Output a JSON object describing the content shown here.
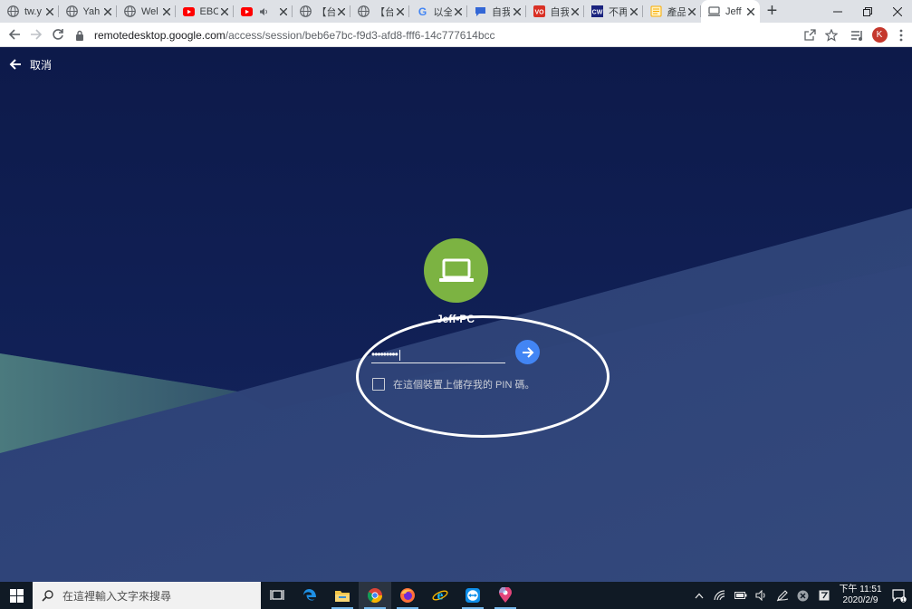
{
  "browser": {
    "tabs": [
      {
        "title": "tw.y",
        "favicon": "globe-icon",
        "color": "#5f6368"
      },
      {
        "title": "Yah",
        "favicon": "globe-icon",
        "color": "#5f6368"
      },
      {
        "title": "Wel",
        "favicon": "globe-icon",
        "color": "#5f6368"
      },
      {
        "title": "EBC",
        "favicon": "youtube-icon",
        "color": "#ff0000"
      },
      {
        "title": "",
        "favicon": "youtube-icon",
        "color": "#ff0000"
      },
      {
        "title": "【台",
        "favicon": "globe-icon",
        "color": "#5f6368"
      },
      {
        "title": "【台",
        "favicon": "globe-icon",
        "color": "#5f6368"
      },
      {
        "title": "以全",
        "favicon": "google-icon",
        "color": "#4285f4"
      },
      {
        "title": "自我",
        "favicon": "chat-icon",
        "color": "#3367d6"
      },
      {
        "title": "自我",
        "favicon": "vo-icon",
        "color": "#d93025"
      },
      {
        "title": "不再",
        "favicon": "cw-icon",
        "color": "#1a237e"
      },
      {
        "title": "產品",
        "favicon": "note-icon",
        "color": "#f9ab00"
      },
      {
        "title": "Jeff",
        "favicon": "remote-desktop-icon",
        "color": "#5f6368"
      }
    ],
    "active_tab": 12,
    "url_host": "remotedesktop.google.com",
    "url_path": "/access/session/beb6e7bc-f9d3-afd8-fff6-14c777614bcc",
    "profile_initial": "K",
    "profile_color": "#c5372c"
  },
  "page": {
    "cancel_label": "取消",
    "host_name": "Jeff-PC",
    "pin_value": "•••••••••",
    "remember_label": "在這個裝置上儲存我的 PIN 碼。",
    "host_icon_color": "#7cb342",
    "submit_color": "#4285f4"
  },
  "taskbar": {
    "search_placeholder": "在這裡輸入文字來搜尋",
    "time": "下午 11:51",
    "date": "2020/2/9",
    "notification_count": "1"
  }
}
